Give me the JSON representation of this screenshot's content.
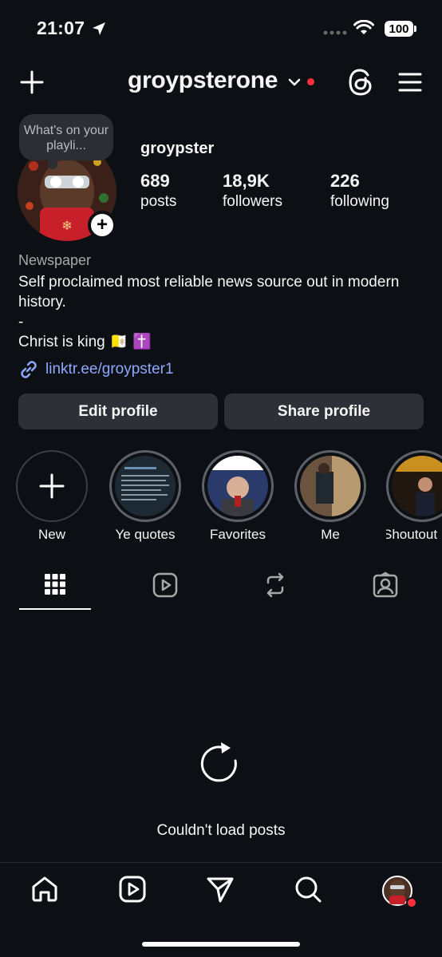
{
  "status_bar": {
    "time": "21:07",
    "battery": "100"
  },
  "header": {
    "username": "groypsterone"
  },
  "profile": {
    "note": "What's on your playli...",
    "display_name": "groypster",
    "stats": [
      {
        "value": "689",
        "label": "posts"
      },
      {
        "value": "18,9K",
        "label": "followers"
      },
      {
        "value": "226",
        "label": "following"
      }
    ],
    "category": "Newspaper",
    "bio": "Self proclaimed most reliable news source out in modern history.\n-\nChrist is king 🇻🇦 ✝️",
    "link": "linktr.ee/groypster1"
  },
  "buttons": {
    "edit_profile": "Edit profile",
    "share_profile": "Share profile"
  },
  "highlights": [
    {
      "label": "New"
    },
    {
      "label": "Ye quotes"
    },
    {
      "label": "Favorites"
    },
    {
      "label": "Me"
    },
    {
      "label": "Shoutout"
    }
  ],
  "posts": {
    "error": "Couldn't load posts"
  },
  "colors": {
    "background": "#0c1014",
    "button": "#2d3036",
    "link": "#8ea8ff",
    "notification": "#ff3040"
  },
  "icons": [
    "location-arrow-icon",
    "signal-icon",
    "wifi-icon",
    "plus-icon",
    "chevron-down-icon",
    "threads-icon",
    "menu-icon",
    "link-icon",
    "grid-icon",
    "reels-icon",
    "reposts-icon",
    "tagged-icon",
    "reload-icon",
    "home-icon",
    "reels-nav-icon",
    "send-icon",
    "search-icon"
  ]
}
